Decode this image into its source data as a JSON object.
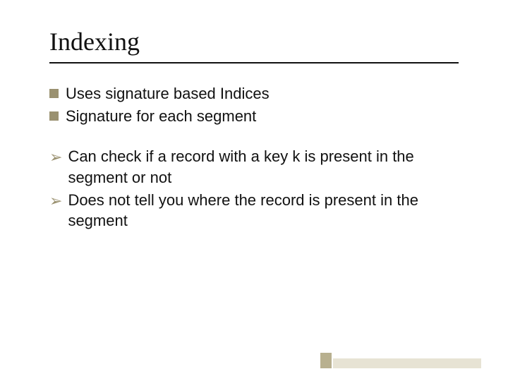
{
  "title": "Indexing",
  "group1": {
    "items": [
      {
        "text": "Uses signature based Indices"
      },
      {
        "text": "Signature for each segment"
      }
    ]
  },
  "group2": {
    "items": [
      {
        "text": "Can check if a record with a key k is present in the segment or not"
      },
      {
        "text": "Does not tell you where the record is present in the segment"
      }
    ]
  }
}
